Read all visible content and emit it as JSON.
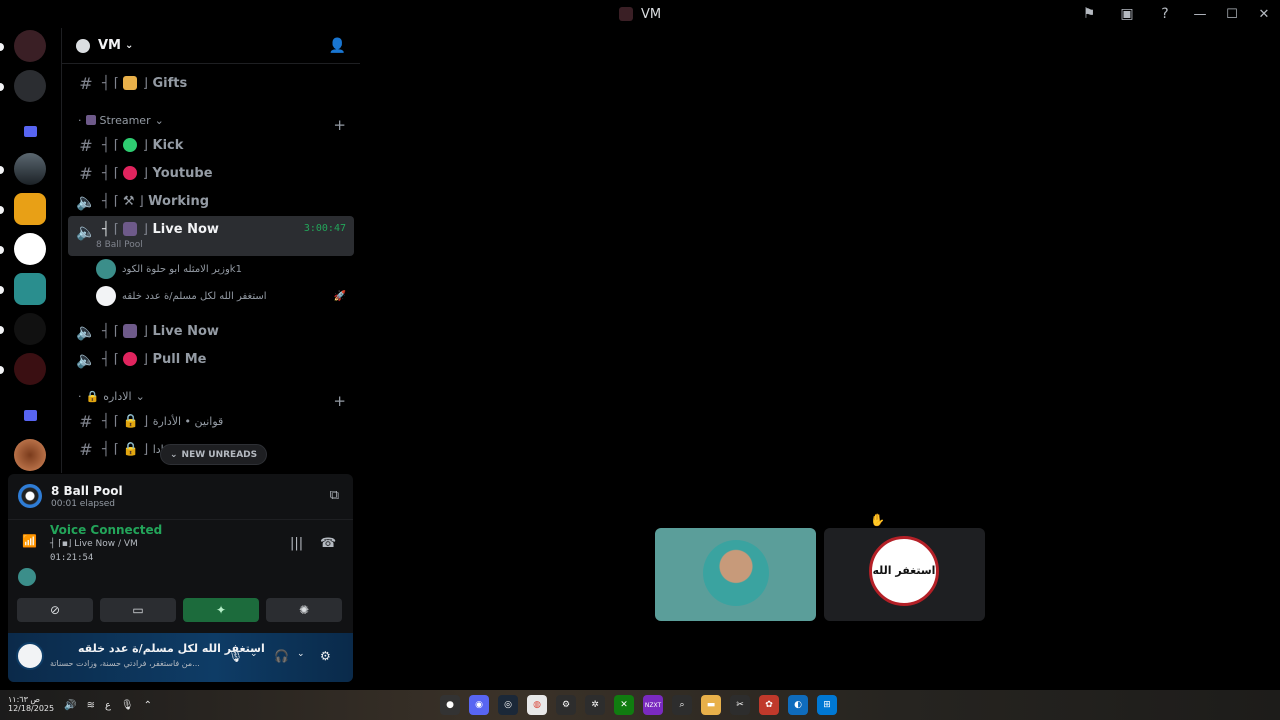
{
  "window": {
    "title": "VM"
  },
  "guild": {
    "name": "VM"
  },
  "channels": {
    "gifts": "Gifts",
    "cat_streamer": "Streamer",
    "kick": "Kick",
    "youtube": "Youtube",
    "working": "Working",
    "live_now": "Live Now",
    "live_now_time": "3:00:47",
    "live_now_activity": "8 Ball Pool",
    "voice_users": [
      "وزير الامثله ابو حلوة الكودk1",
      "استغفر الله لكل مسلم/ة عدد خلقه"
    ],
    "live_now_2": "Live Now",
    "pull_me": "Pull Me",
    "cat_admin": "الاداره",
    "rules": "قوانين • الأدارة",
    "partial": "ادا"
  },
  "new_unreads": "NEW UNREADS",
  "activity": {
    "name": "8 Ball Pool",
    "elapsed": "00:01 elapsed"
  },
  "voice": {
    "status": "Voice Connected",
    "channel": "Live Now / VM",
    "elapsed": "01:21:54"
  },
  "user": {
    "name": "استغفر الله لكل مسلم/ة عدد خلقه",
    "status": "من فاستغفر، فرادتي حسنة، وزادت حسناتة..."
  },
  "taskbar": {
    "time": "ص ١١:٦٣",
    "date": "12/18/2025",
    "lang": "ع"
  },
  "colors": {
    "accent_green": "#23a55a",
    "brand": "#5865f2"
  }
}
